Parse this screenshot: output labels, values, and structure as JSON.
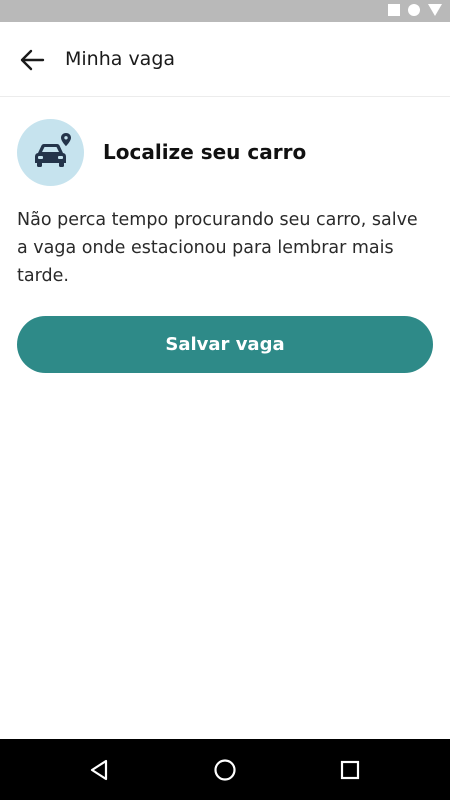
{
  "app_bar": {
    "title": "Minha vaga",
    "back_icon": "arrow-back-icon"
  },
  "feature": {
    "icon": "car-location-icon",
    "title": "Localize seu carro",
    "description": "Não perca tempo procurando seu carro, salve a vaga onde estacionou para lembrar mais tarde."
  },
  "actions": {
    "save_label": "Salvar vaga"
  },
  "colors": {
    "accent": "#2e8a88",
    "icon_bg": "#c6e3ee",
    "icon_fg": "#24344a"
  },
  "system_nav": [
    "back-triangle-icon",
    "home-circle-icon",
    "recents-square-icon"
  ]
}
